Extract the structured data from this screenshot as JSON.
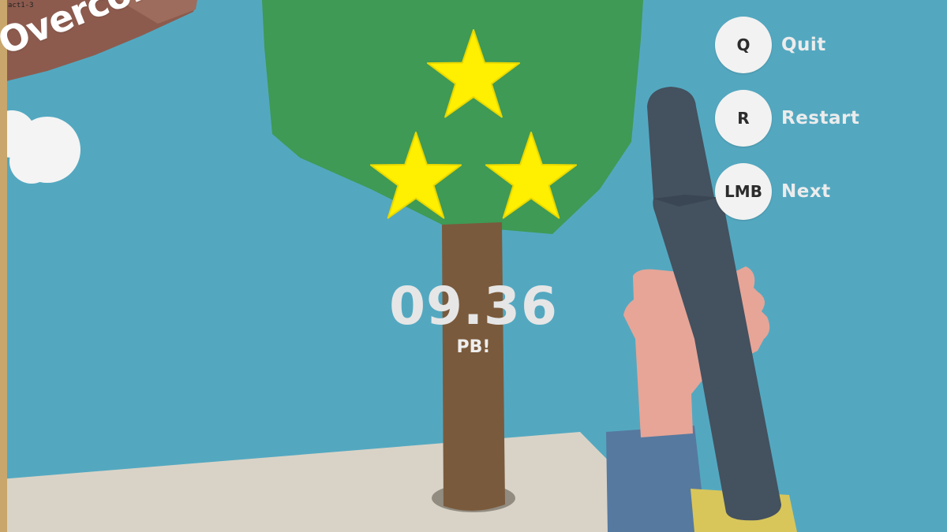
{
  "hud": {
    "level_label": "act1-3",
    "banner_text": "Overcome!",
    "timer": "09.36",
    "result_label": "PB!",
    "stars_earned": 3,
    "stars_total": 3
  },
  "controls": [
    {
      "key": "Q",
      "action": "Quit"
    },
    {
      "key": "R",
      "action": "Restart"
    },
    {
      "key": "LMB",
      "action": "Next"
    }
  ],
  "colors": {
    "sky": "#53a8c0",
    "star": "#ffef00",
    "foliage": "#3e9a55",
    "trunk": "#7a5a3c",
    "pipe": "#44515f",
    "ground": "#d9d3c7"
  }
}
